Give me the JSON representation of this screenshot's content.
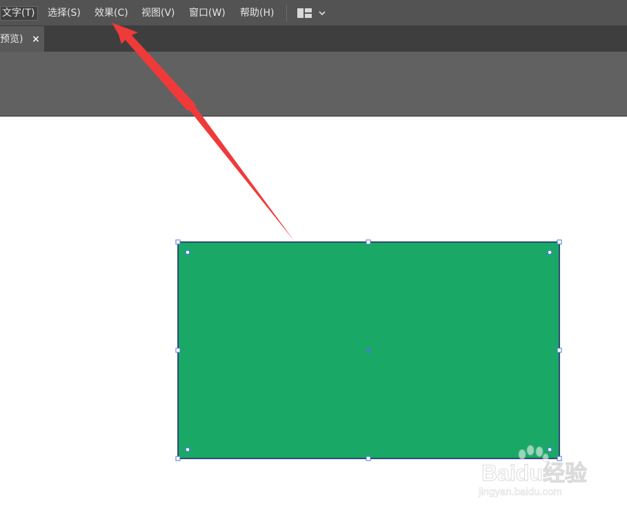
{
  "menu": {
    "items": [
      {
        "label": "文字(T)"
      },
      {
        "label": "选择(S)"
      },
      {
        "label": "效果(C)"
      },
      {
        "label": "视图(V)"
      },
      {
        "label": "窗口(W)"
      },
      {
        "label": "帮助(H)"
      }
    ],
    "workspace_icon": "workspace-layout-icon",
    "dropdown_icon": "chevron-down-icon"
  },
  "document_tab": {
    "label": "预览)",
    "close_symbol": "×"
  },
  "canvas": {
    "background": "#ffffff",
    "shape": {
      "fill": "#1aa867",
      "stroke": "#1a1f6e",
      "selection_color": "#4a7bd6"
    }
  },
  "annotation": {
    "arrow_color": "#f03a3a"
  },
  "watermark": {
    "brand": "Baidu经验",
    "url": "jingyan.baidu.com"
  }
}
